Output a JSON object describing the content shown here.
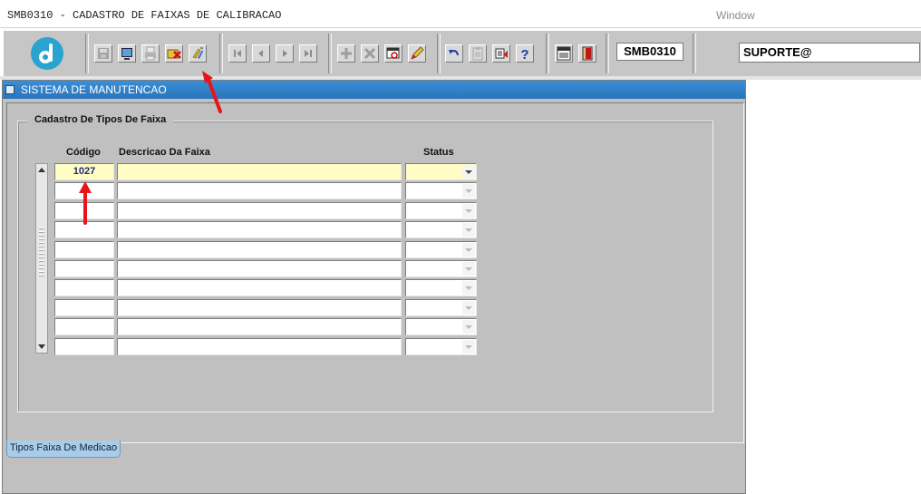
{
  "app": {
    "title": "SMB0310 - CADASTRO DE FAIXAS DE CALIBRACAO",
    "window_menu": "Window"
  },
  "toolbar": {
    "form_code": "SMB0310",
    "user": "SUPORTE@",
    "icons": [
      "logo-icon",
      "save-icon",
      "print-screen-icon",
      "print-icon",
      "clear-icon",
      "execute-query-icon",
      "first-record-icon",
      "previous-record-icon",
      "next-record-icon",
      "last-record-icon",
      "insert-record-icon",
      "delete-record-icon",
      "find-icon",
      "edit-icon",
      "undo-icon",
      "clipboard-icon",
      "list-of-values-icon",
      "help-icon",
      "menu-icon",
      "exit-icon"
    ]
  },
  "window": {
    "title": "SISTEMA DE MANUTENCAO"
  },
  "form": {
    "frame_title": "Cadastro De Tipos De Faixa",
    "columns": {
      "codigo": "Código",
      "descricao": "Descricao Da Faixa",
      "status": "Status"
    },
    "rows": [
      {
        "codigo": "1027",
        "descricao": "",
        "status": ""
      },
      {
        "codigo": "",
        "descricao": "",
        "status": ""
      },
      {
        "codigo": "",
        "descricao": "",
        "status": ""
      },
      {
        "codigo": "",
        "descricao": "",
        "status": ""
      },
      {
        "codigo": "",
        "descricao": "",
        "status": ""
      },
      {
        "codigo": "",
        "descricao": "",
        "status": ""
      },
      {
        "codigo": "",
        "descricao": "",
        "status": ""
      },
      {
        "codigo": "",
        "descricao": "",
        "status": ""
      },
      {
        "codigo": "",
        "descricao": "",
        "status": ""
      },
      {
        "codigo": "",
        "descricao": "",
        "status": ""
      }
    ]
  },
  "tabs": [
    {
      "label": "Tipos Faixa De Medicao",
      "active": true
    }
  ],
  "colors": {
    "titlebar": "#2a7fc8",
    "current_row": "#fffcc4",
    "annotation_arrow": "#e8141c",
    "tab_active": "#a9cde9"
  }
}
